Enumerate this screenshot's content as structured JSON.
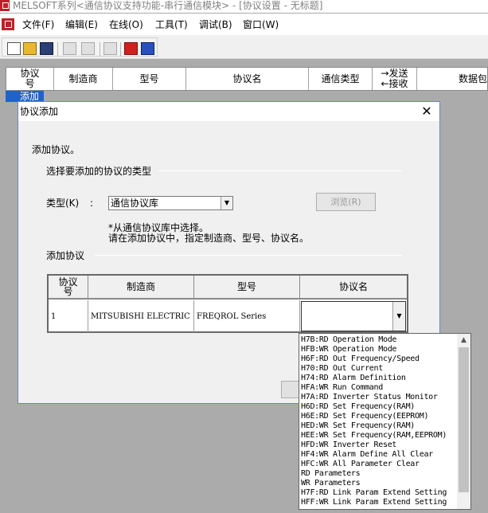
{
  "window": {
    "title": "MELSOFT系列<通信协议支持功能-串行通信模块> - [协议设置 - 无标题]"
  },
  "menu": {
    "items": [
      {
        "label": "文件(F)"
      },
      {
        "label": "编辑(E)"
      },
      {
        "label": "在线(O)"
      },
      {
        "label": "工具(T)"
      },
      {
        "label": "调试(B)"
      },
      {
        "label": "窗口(W)"
      }
    ]
  },
  "toolbar": {
    "icons": [
      "new-file-icon",
      "open-folder-icon",
      "save-icon",
      "copy-icon",
      "paste-icon",
      "monitor-icon",
      "write-icon",
      "read-icon"
    ]
  },
  "main_table": {
    "columns": {
      "protocol_no_line1": "协议",
      "protocol_no_line2": "号",
      "maker": "制造商",
      "model": "型号",
      "protocol_name": "协议名",
      "comm_type": "通信类型",
      "send": "→发送",
      "receive": "←接收",
      "packet": "数据包"
    },
    "add_row_label": "添加"
  },
  "dialog": {
    "title": "协议添加",
    "close": "✕",
    "instruction": "添加协议。",
    "group_type_label": "选择要添加的协议的类型",
    "type_label": "类型(K)",
    "type_colon": ":",
    "type_value": "通信协议库",
    "browse_label": "浏览(R)",
    "note_line1": "*从通信协议库中选择。",
    "note_line2": "请在添加协议中，指定制造商、型号、协议名。",
    "group_add_label": "添加协议",
    "grid": {
      "headers": {
        "no_line1": "协议",
        "no_line2": "号",
        "maker": "制造商",
        "model": "型号",
        "protocol_name": "协议名"
      },
      "row": {
        "no": "1",
        "maker": "MITSUBISHI ELECTRIC",
        "model": "FREQROL Series",
        "protocol_name": ""
      }
    }
  },
  "dropdown": {
    "items": [
      "H7B:RD Operation Mode",
      "HFB:WR Operation Mode",
      "H6F:RD Out Frequency/Speed",
      "H70:RD Out Current",
      "H74:RD Alarm Definition",
      "HFA:WR Run Command",
      "H7A:RD Inverter Status Monitor",
      "H6D:RD Set Frequency(RAM)",
      "H6E:RD Set Frequency(EEPROM)",
      "HED:WR Set Frequency(RAM)",
      "HEE:WR Set Frequency(RAM,EEPROM)",
      "HFD:WR Inverter Reset",
      "HF4:WR Alarm Define All Clear",
      "HFC:WR All Parameter Clear",
      "RD Parameters",
      "WR Parameters",
      "H7F:RD Link Param Extend Setting",
      "HFF:WR Link Param Extend Setting"
    ]
  }
}
